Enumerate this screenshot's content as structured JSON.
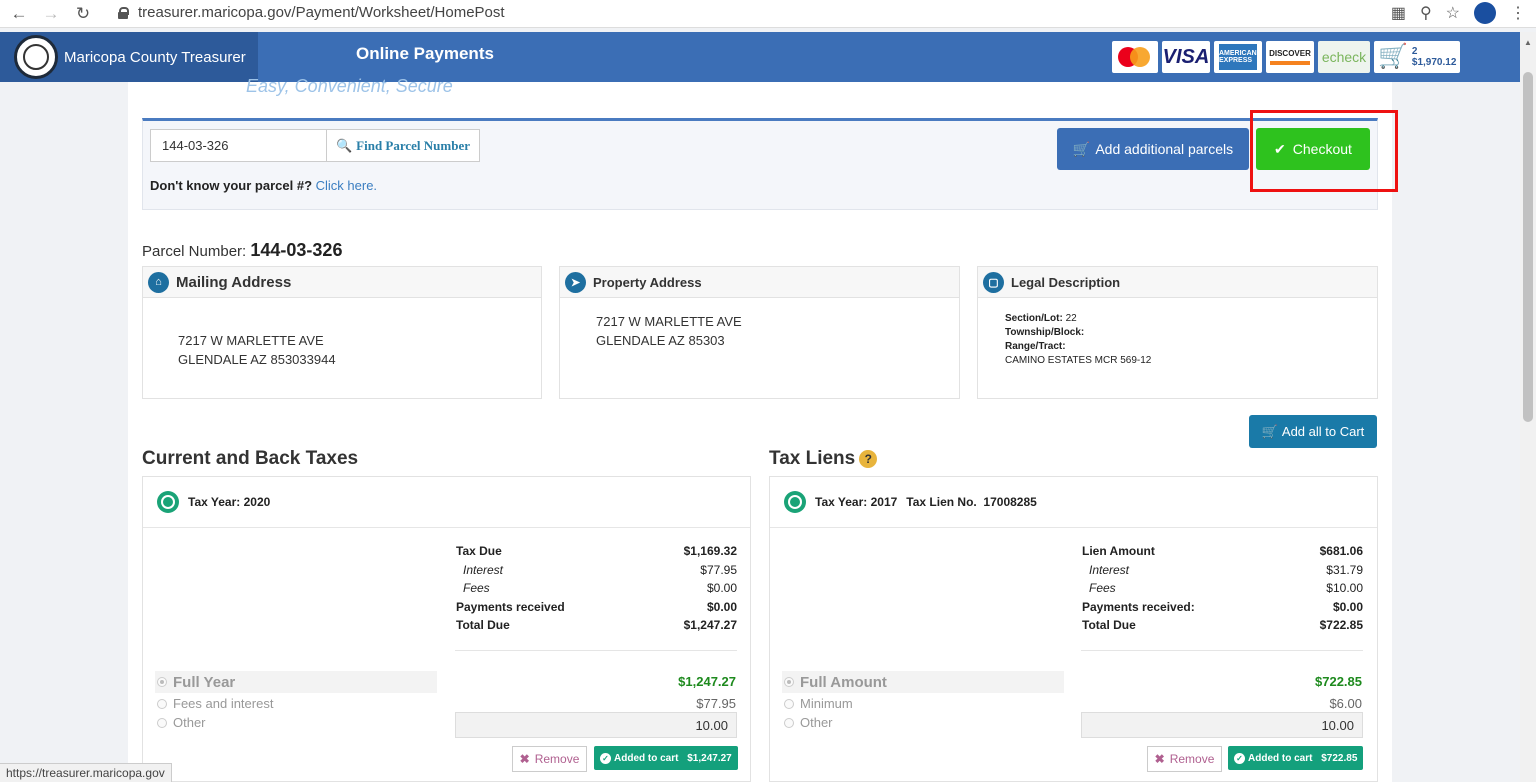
{
  "browser": {
    "url": "treasurer.maricopa.gov/Payment/Worksheet/HomePost",
    "status_url": "https://treasurer.maricopa.gov"
  },
  "header": {
    "brand": "Maricopa County Treasurer",
    "title": "Online Payments",
    "tagline": "Easy, Convenient, Secure",
    "cards": {
      "visa": "VISA",
      "discover": "DISCOVER",
      "echeck": "echeck",
      "amex": "AMERICAN EXPRESS"
    },
    "cart": {
      "count": "2",
      "total": "$1,970.12"
    }
  },
  "search": {
    "parcel_value": "144-03-326",
    "find_label": "Find Parcel Number",
    "dont_know": "Don't know your parcel #?",
    "click_here": "Click here.",
    "add_parcels_label": "Add additional parcels",
    "checkout_label": "Checkout"
  },
  "parcel": {
    "label": "Parcel Number:",
    "number": "144-03-326"
  },
  "mailing": {
    "title": "Mailing Address",
    "line1": "7217 W MARLETTE AVE",
    "line2": "GLENDALE AZ 853033944"
  },
  "property": {
    "title": "Property Address",
    "line1": "7217 W MARLETTE AVE",
    "line2": "GLENDALE AZ 85303"
  },
  "legal": {
    "title": "Legal Description",
    "section_label": "Section/Lot:",
    "section_value": "22",
    "township_label": "Township/Block:",
    "range_label": "Range/Tract:",
    "description": "CAMINO ESTATES MCR 569-12"
  },
  "add_all_label": "Add all to Cart",
  "taxes": {
    "title": "Current and Back Taxes",
    "year_label": "Tax Year: 2020",
    "rows": [
      {
        "label": "Tax Due",
        "value": "$1,169.32"
      },
      {
        "label": "Interest",
        "value": "$77.95"
      },
      {
        "label": "Fees",
        "value": "$0.00"
      },
      {
        "label": "Payments received",
        "value": "$0.00"
      },
      {
        "label": "Total Due",
        "value": "$1,247.27"
      }
    ],
    "full_label": "Full Year",
    "full_amount": "$1,247.27",
    "option2_label": "Fees and interest",
    "option2_amount": "$77.95",
    "other_label": "Other",
    "other_value": "10.00",
    "remove_label": "Remove",
    "added_label": "Added to cart",
    "added_amount": "$1,247.27"
  },
  "liens": {
    "title": "Tax Liens",
    "help": "?",
    "year_label": "Tax Year: 2017",
    "lien_label": "Tax Lien No.",
    "lien_no": "17008285",
    "rows": [
      {
        "label": "Lien Amount",
        "value": "$681.06"
      },
      {
        "label": "Interest",
        "value": "$31.79"
      },
      {
        "label": "Fees",
        "value": "$10.00"
      },
      {
        "label": "Payments received:",
        "value": "$0.00"
      },
      {
        "label": "Total Due",
        "value": "$722.85"
      }
    ],
    "full_label": "Full Amount",
    "full_amount": "$722.85",
    "option2_label": "Minimum",
    "option2_amount": "$6.00",
    "other_label": "Other",
    "other_value": "10.00",
    "remove_label": "Remove",
    "added_label": "Added to cart",
    "added_amount": "$722.85"
  }
}
